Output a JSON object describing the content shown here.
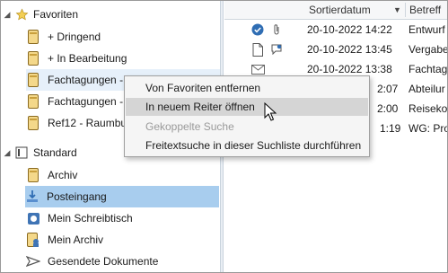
{
  "sidebar": {
    "favorites": {
      "label": "Favoriten",
      "items": [
        {
          "label": "+ Dringend"
        },
        {
          "label": "+ In Bearbeitung"
        },
        {
          "label": "Fachtagungen - A"
        },
        {
          "label": "Fachtagungen -"
        },
        {
          "label": "Ref12 - Raumbu"
        }
      ]
    },
    "standard": {
      "label": "Standard",
      "items": [
        {
          "label": "Archiv"
        },
        {
          "label": "Posteingang"
        },
        {
          "label": "Mein Schreibtisch"
        },
        {
          "label": "Mein Archiv"
        },
        {
          "label": "Gesendete Dokumente"
        }
      ]
    }
  },
  "list": {
    "columns": {
      "sort": "Sortierdatum",
      "subject": "Betreff"
    },
    "rows": [
      {
        "date": "20-10-2022 14:22",
        "subject": "Entwurf"
      },
      {
        "date": "20-10-2022 13:45",
        "subject": "Vergabe"
      },
      {
        "date": "20-10-2022 13:38",
        "subject": "Fachtag"
      },
      {
        "date": "2:07",
        "subject": "Abteilur"
      },
      {
        "date": "2:00",
        "subject": "Reisekos"
      },
      {
        "date": "1:19",
        "subject": "WG: Pro"
      }
    ]
  },
  "context_menu": {
    "items": [
      {
        "label": "Von Favoriten entfernen"
      },
      {
        "label": "In neuem Reiter öffnen"
      },
      {
        "label": "Gekoppelte Suche"
      },
      {
        "label": "Freitextsuche in dieser Suchliste durchführen"
      }
    ]
  },
  "colors": {
    "selected": "#a8cdee",
    "menu_highlight": "#d5d5d5",
    "disabled_text": "#9a9a9a"
  }
}
